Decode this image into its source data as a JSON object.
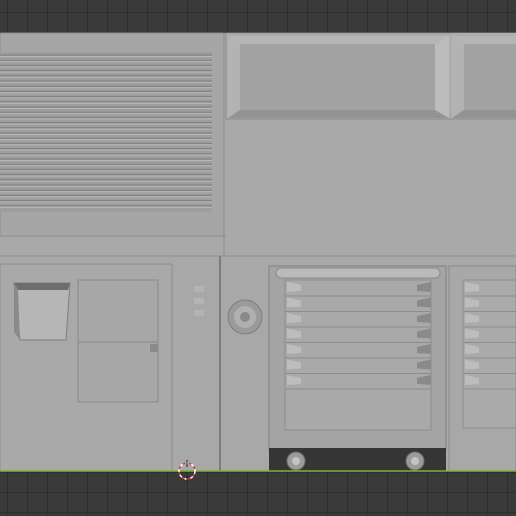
{
  "viewport": {
    "background": "#3a3a3a",
    "grid_color": "#2e2e2e",
    "mesh_color": "#a7a7a7",
    "mesh_dark": "#8c8c8c",
    "mesh_light": "#c2c2c2",
    "ground_line_color": "#7ab03e"
  },
  "cursor": {
    "icon": "3d-cursor-icon"
  }
}
